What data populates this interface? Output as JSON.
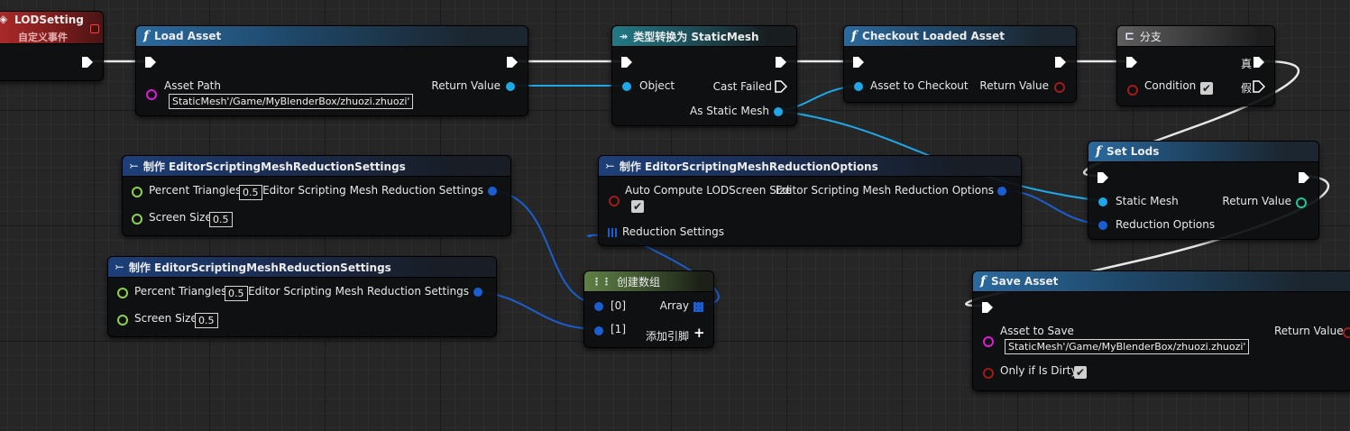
{
  "event": {
    "title": "LODSetting",
    "subtitle": "自定义事件"
  },
  "load_asset": {
    "title": "Load Asset",
    "asset_path_label": "Asset Path",
    "asset_path_value": "StaticMesh'/Game/MyBlenderBox/zhuozi.zhuozi'",
    "return_value_label": "Return Value"
  },
  "cast": {
    "title": "类型转换为 StaticMesh",
    "object_label": "Object",
    "cast_failed_label": "Cast Failed",
    "as_static_mesh_label": "As Static Mesh"
  },
  "checkout": {
    "title": "Checkout Loaded Asset",
    "asset_label": "Asset to Checkout",
    "return_value_label": "Return Value"
  },
  "branch": {
    "title": "分支",
    "condition_label": "Condition",
    "true_label": "真",
    "false_label": "假",
    "condition_checked": true
  },
  "set_lods": {
    "title": "Set Lods",
    "static_mesh_label": "Static Mesh",
    "reduction_options_label": "Reduction Options",
    "return_value_label": "Return Value"
  },
  "make_settings_1": {
    "title": "制作 EditorScriptingMeshReductionSettings",
    "percent_label": "Percent Triangles",
    "percent_value": "0.5",
    "screen_label": "Screen Size",
    "screen_value": "0.5",
    "output_label": "Editor Scripting Mesh Reduction Settings"
  },
  "make_settings_2": {
    "title": "制作 EditorScriptingMeshReductionSettings",
    "percent_label": "Percent Triangles",
    "percent_value": "0.5",
    "screen_label": "Screen Size",
    "screen_value": "0.5",
    "output_label": "Editor Scripting Mesh Reduction Settings"
  },
  "make_options": {
    "title": "制作 EditorScriptingMeshReductionOptions",
    "auto_compute_label": "Auto Compute LODScreen Size",
    "auto_compute_checked": true,
    "output_label": "Editor Scripting Mesh Reduction Options",
    "reduction_settings_label": "Reduction Settings"
  },
  "make_array": {
    "title": "创建数组",
    "item0_label": "[0]",
    "item1_label": "[1]",
    "array_label": "Array",
    "add_pin_label": "添加引脚"
  },
  "save_asset": {
    "title": "Save Asset",
    "asset_label": "Asset to Save",
    "asset_value": "StaticMesh'/Game/MyBlenderBox/zhuozi.zhuozi'",
    "dirty_label": "Only if Is Dirty",
    "dirty_checked": true,
    "return_value_label": "Return Value"
  },
  "colors": {
    "exec": "#ffffff",
    "object_pin": "#1fa8e8",
    "struct_pin": "#1a5fd1",
    "float_pin": "#8fd14f",
    "bool_pin": "#a11b1b",
    "softref_pin": "#e01ad6",
    "sm_return_pin": "#1ec4a0"
  }
}
